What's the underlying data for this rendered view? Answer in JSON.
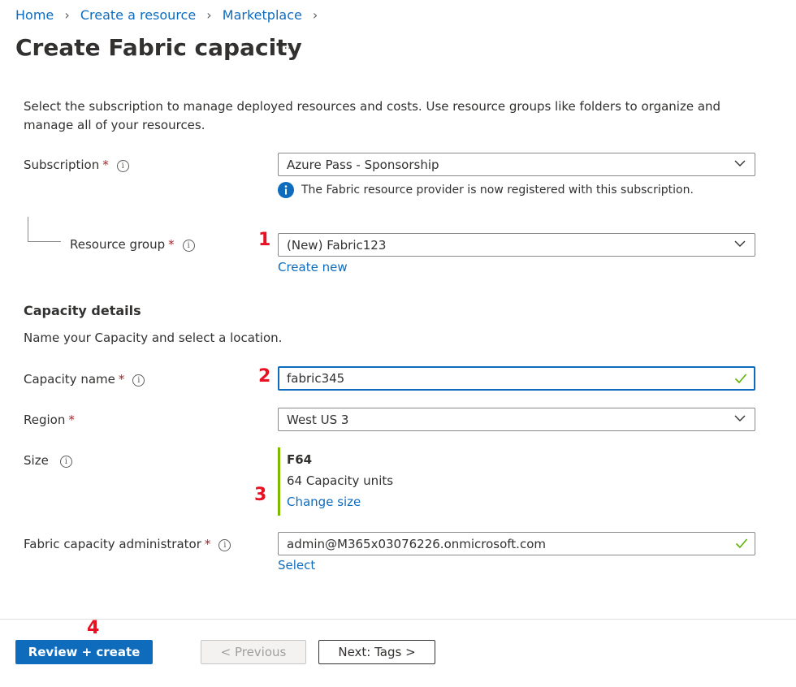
{
  "breadcrumb": {
    "items": [
      "Home",
      "Create a resource",
      "Marketplace"
    ]
  },
  "page": {
    "title": "Create Fabric capacity",
    "more": "···"
  },
  "intro": "Select the subscription to manage deployed resources and costs. Use resource groups like folders to organize and manage all of your resources.",
  "subscription": {
    "label": "Subscription",
    "value": "Azure Pass - Sponsorship",
    "notice": "The Fabric resource provider is now registered with this subscription."
  },
  "resource_group": {
    "label": "Resource group",
    "value": "(New) Fabric123",
    "create_new": "Create new"
  },
  "capacity": {
    "heading": "Capacity details",
    "description": "Name your Capacity and select a location.",
    "name_label": "Capacity name",
    "name_value": "fabric345",
    "region_label": "Region",
    "region_value": "West US 3",
    "size_label": "Size",
    "size_sku": "F64",
    "size_units": "64 Capacity units",
    "change_size": "Change size",
    "admin_label": "Fabric capacity administrator",
    "admin_value": "admin@M365x03076226.onmicrosoft.com",
    "select": "Select"
  },
  "annotations": [
    "1",
    "2",
    "3",
    "4"
  ],
  "footer": {
    "review_create": "Review + create",
    "previous": "< Previous",
    "next": "Next: Tags >"
  },
  "required_marker": "*",
  "info_glyph": "i",
  "colors": {
    "accent": "#0f6cbd",
    "required": "#a4262c",
    "annotation": "#e81123",
    "valid_check": "#5db300",
    "size_bar": "#7fba00"
  }
}
